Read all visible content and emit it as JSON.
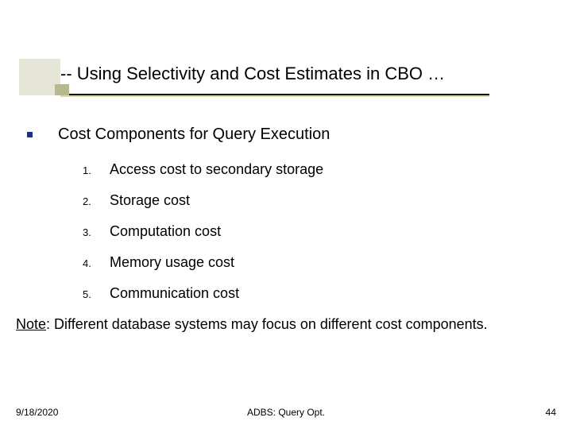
{
  "title": "-- Using Selectivity and Cost Estimates in CBO …",
  "bullet": "Cost Components for Query Execution",
  "items": [
    "Access cost to secondary storage",
    "Storage cost",
    "Computation cost",
    "Memory usage cost",
    "Communication cost"
  ],
  "note_label": "Note",
  "note_text": ": Different database systems may focus on different cost components.",
  "footer": {
    "date": "9/18/2020",
    "center": "ADBS: Query Opt.",
    "page": "44"
  }
}
